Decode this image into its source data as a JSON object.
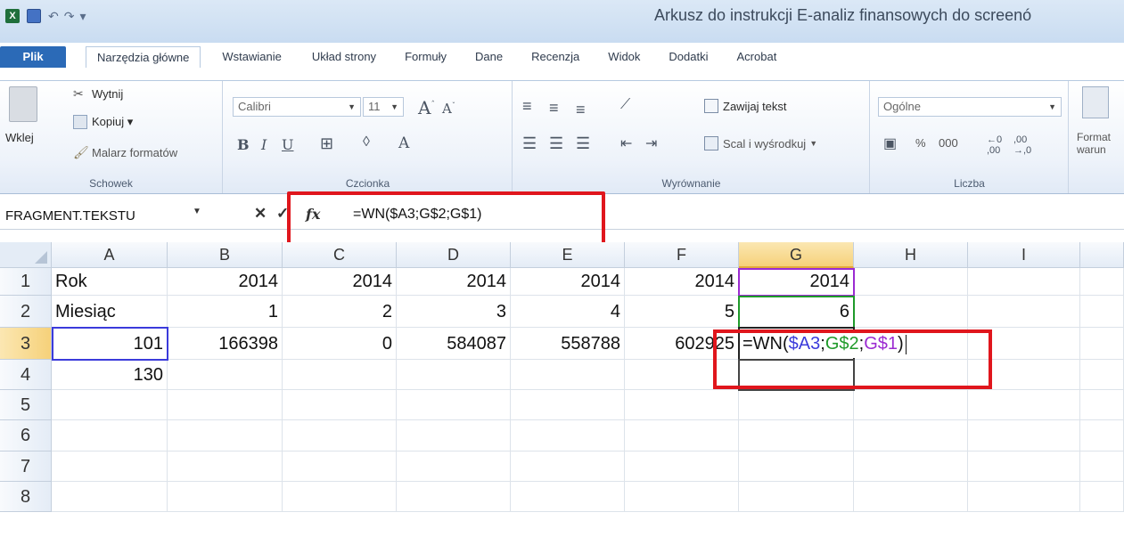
{
  "title_bar": {
    "app_icon": "X",
    "document_title": "Arkusz do instrukcji E-analiz finansowych do screenó"
  },
  "ribbon_tabs": [
    "Plik",
    "Narzędzia główne",
    "Wstawianie",
    "Układ strony",
    "Formuły",
    "Dane",
    "Recenzja",
    "Widok",
    "Dodatki",
    "Acrobat"
  ],
  "ribbon": {
    "clipboard": {
      "paste": "Wklej",
      "cut": "Wytnij",
      "copy": "Kopiuj ▾",
      "format_painter": "Malarz formatów",
      "label": "Schowek"
    },
    "font": {
      "font_name": "Calibri",
      "font_size": "11",
      "label": "Czcionka"
    },
    "alignment": {
      "wrap_text": "Zawijaj tekst",
      "merge_center": "Scal i wyśrodkuj",
      "label": "Wyrównanie"
    },
    "number": {
      "format": "Ogólne",
      "percent": "%",
      "thousands": "000",
      "label": "Liczba"
    },
    "styles": {
      "conditional_formatting": "Format warun"
    }
  },
  "formula_bar": {
    "name_box": "FRAGMENT.TEKSTU",
    "cancel": "✕",
    "enter": "✓",
    "fx": "fx",
    "formula": "=WN($A3;G$2;G$1)"
  },
  "columns": [
    "A",
    "B",
    "C",
    "D",
    "E",
    "F",
    "G",
    "H",
    "I"
  ],
  "rows": [
    "1",
    "2",
    "3",
    "4",
    "5",
    "6",
    "7",
    "8"
  ],
  "cells": {
    "r1": [
      "Rok",
      "2014",
      "2014",
      "2014",
      "2014",
      "2014",
      "2014",
      "",
      ""
    ],
    "r2": [
      "Miesiąc",
      "1",
      "2",
      "3",
      "4",
      "5",
      "6",
      "",
      ""
    ],
    "r3": [
      "101",
      "166398",
      "0",
      "584087",
      "558788",
      "602925",
      "",
      "",
      ""
    ],
    "r4": [
      "130",
      "",
      "",
      "",
      "",
      "",
      "",
      "",
      ""
    ]
  },
  "editing_cell": {
    "prefix": "=WN(",
    "ref1": "$A3",
    "sep1": ";",
    "ref2": "G$2",
    "sep2": ";",
    "ref3": "G$1",
    "suffix": ")"
  },
  "colors": {
    "ref1": "#3b3bdb",
    "ref2": "#1f9a2a",
    "ref3": "#9b2bd1",
    "highlight": "#e0161d"
  }
}
